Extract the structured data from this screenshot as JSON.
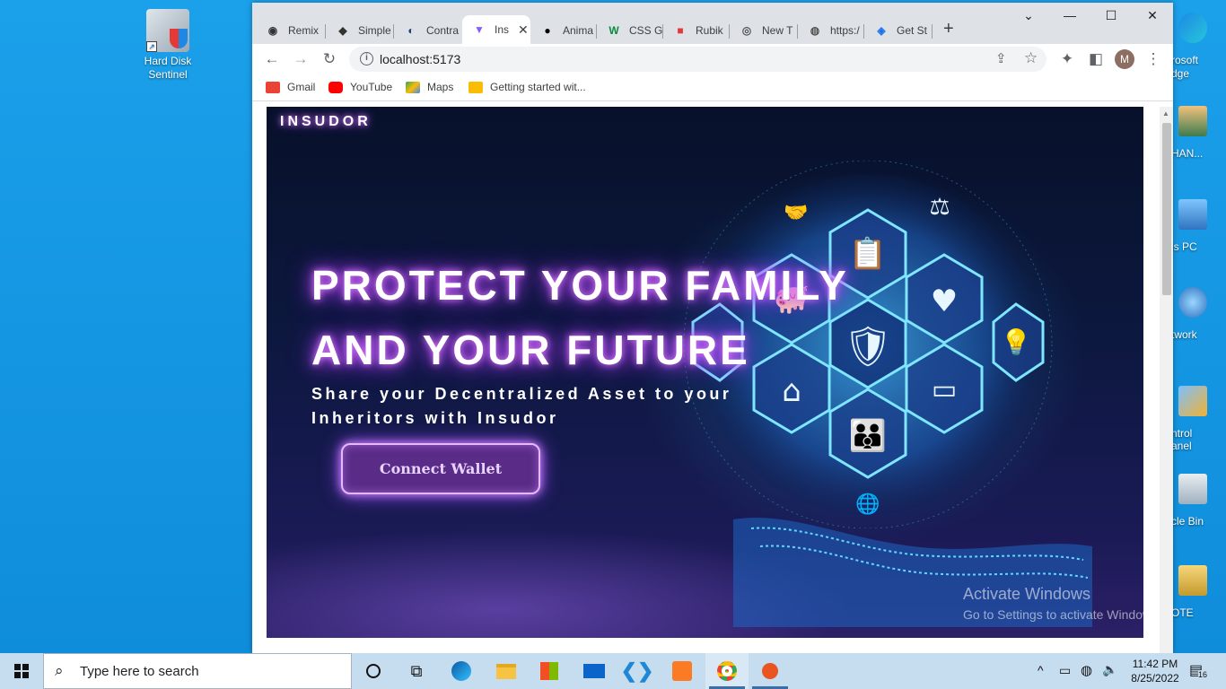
{
  "desktop": {
    "left_icons": [
      {
        "label": "Hard Disk Sentinel"
      }
    ],
    "right_icons": [
      {
        "label": "rosoft\ndge"
      },
      {
        "label": "HAN..."
      },
      {
        "label": "is PC"
      },
      {
        "label": "twork"
      },
      {
        "label": "ntrol\nanel"
      },
      {
        "label": "cle Bin"
      },
      {
        "label": "OTE"
      }
    ],
    "watermark": {
      "line1": "Activate Windows",
      "line2": "Go to Settings to activate Windows."
    }
  },
  "browser": {
    "tabs": [
      {
        "label": "Remix",
        "icon": "remix-icon"
      },
      {
        "label": "Simple",
        "icon": "ethereum-icon"
      },
      {
        "label": "Contra",
        "icon": "contract-icon"
      },
      {
        "label": "Ins",
        "icon": "vite-icon",
        "active": true
      },
      {
        "label": "Anima",
        "icon": "anima-icon"
      },
      {
        "label": "CSS Gr",
        "icon": "w-icon"
      },
      {
        "label": "Rubik",
        "icon": "rubik-icon"
      },
      {
        "label": "New T",
        "icon": "chrome-icon"
      },
      {
        "label": "https:/",
        "icon": "globe-icon"
      },
      {
        "label": "Get St",
        "icon": "get-started-icon"
      }
    ],
    "url": "localhost:5173",
    "profile_initial": "M",
    "bookmarks": [
      {
        "label": "Gmail",
        "color": "#ea4335"
      },
      {
        "label": "YouTube",
        "color": "#ff0000"
      },
      {
        "label": "Maps",
        "color": "#34a853"
      },
      {
        "label": "Getting started wit...",
        "color": "#fbbc04"
      }
    ]
  },
  "page": {
    "brand": "INSUDOR",
    "headline_line1": "PROTECT YOUR FAMILY",
    "headline_line2": "AND YOUR FUTURE",
    "subtitle_line1": "Share your Decentralized Asset to your",
    "subtitle_line2": "Inheritors with Insudor",
    "cta_label": "Connect Wallet"
  },
  "taskbar": {
    "search_placeholder": "Type here to search",
    "time": "11:42 PM",
    "date": "8/25/2022",
    "notification_count": "16"
  }
}
